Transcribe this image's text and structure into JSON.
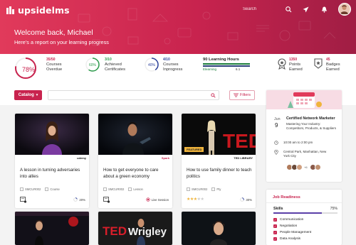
{
  "app": {
    "brand": "upsidelms"
  },
  "header": {
    "search_label": "Search",
    "welcome": "Welcome back, Michael",
    "subtitle": "Here’s a report on your learning progress"
  },
  "stats": {
    "overdue": {
      "value": "78%",
      "count": "35/50",
      "label_line1": "Courses",
      "label_line2": "Overdue",
      "color": "#c8234e",
      "progress": 0.78
    },
    "certificates": {
      "value": "60%",
      "count": "3/10",
      "label_line1": "Achieved",
      "label_line2": "Certificates",
      "color": "#2a9a4a",
      "progress": 0.6
    },
    "inprogress": {
      "value": "40%",
      "count": "4/10",
      "label_line1": "Courses",
      "label_line2": "Inprogress",
      "color": "#2a3f9a",
      "progress": 0.4
    },
    "hours": {
      "title": "90 Learning Hours",
      "learning_label": "Elearning",
      "value_label": "6.1"
    },
    "points": {
      "value": "1350",
      "label_line1": "Points",
      "label_line2": "Earned"
    },
    "badges": {
      "value": "45",
      "label_line1": "Badges",
      "label_line2": "Earned"
    }
  },
  "toolbar": {
    "catalog_label": "Catalog",
    "search_placeholder": "",
    "filters_label": "Filters"
  },
  "cards": [
    {
      "title": "A lesson in turning adversaries into allies",
      "code": "SMCUR002",
      "type_label": "Course",
      "brand": "udemy",
      "progress_label": "20%",
      "progress": 0.2
    },
    {
      "title": "How to get everyone to care about a green economy",
      "code": "SMCUR002",
      "type_label": "Lesson",
      "brand": "Spark",
      "status_label": "Live Session"
    },
    {
      "title": "How to use family dinner to teach politics",
      "code": "SMCUR002",
      "type_label": "Pty",
      "brand": "TED LIBRARY",
      "badge": "FEATURED",
      "progress_label": "30%",
      "progress": 0.3
    }
  ],
  "event": {
    "month": "Jun",
    "day": "9",
    "title": "Certified Network Marketer",
    "description": "Mastering Your Industry: Competitors, Products, & Suppliers",
    "time": "10:00 am to 2:00 pm",
    "location": "Central Park, Manhattan, New York City",
    "more_attendees": "+6"
  },
  "job_readiness": {
    "title": "Job Readiness",
    "skills_label": "Skills",
    "skills_pct": "75%",
    "skills_progress": 0.75,
    "items": [
      "Communication",
      "Negotiation",
      "People Management",
      "Data Analysis"
    ]
  },
  "colors": {
    "brand": "#c8234e",
    "green": "#2a9a4a",
    "navy": "#2a3f9a",
    "purple": "#5a3fa8"
  }
}
